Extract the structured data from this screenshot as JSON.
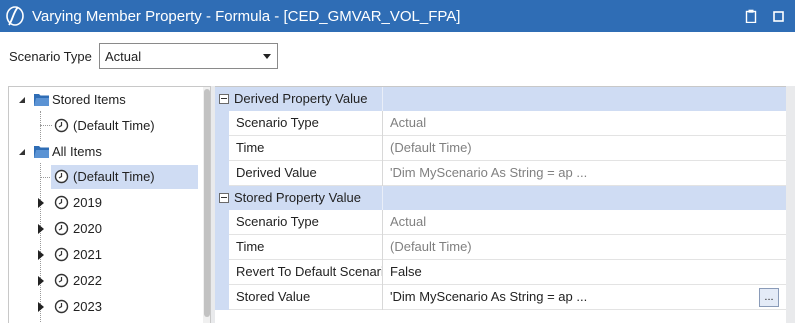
{
  "window": {
    "title": "Varying Member Property - Formula - [CED_GMVAR_VOL_FPA]",
    "logo_icon": "onestream-logo-icon",
    "buttons": [
      "clipboard-icon",
      "maximize-icon"
    ],
    "colors": {
      "titlebar": "#2f6db5",
      "selection": "#cfdcf3"
    }
  },
  "scenario": {
    "label": "Scenario Type",
    "value": "Actual"
  },
  "tree": {
    "nodes": [
      {
        "label": "Stored Items",
        "icon": "folder-icon",
        "expanded": true
      },
      {
        "label": "(Default Time)",
        "icon": "clock-icon"
      },
      {
        "label": "All Items",
        "icon": "folder-icon",
        "expanded": true
      },
      {
        "label": "(Default Time)",
        "icon": "clock-icon",
        "selected": true
      },
      {
        "label": "2019",
        "icon": "clock-icon",
        "expanded": false
      },
      {
        "label": "2020",
        "icon": "clock-icon",
        "expanded": false
      },
      {
        "label": "2021",
        "icon": "clock-icon",
        "expanded": false
      },
      {
        "label": "2022",
        "icon": "clock-icon",
        "expanded": false
      },
      {
        "label": "2023",
        "icon": "clock-icon",
        "expanded": false
      }
    ]
  },
  "grid": {
    "derived": {
      "title": "Derived Property Value",
      "rows": [
        {
          "name": "Scenario Type",
          "value": "Actual"
        },
        {
          "name": "Time",
          "value": "(Default Time)"
        },
        {
          "name": "Derived Value",
          "value": "'Dim MyScenario As String = ap ..."
        }
      ]
    },
    "stored": {
      "title": "Stored Property Value",
      "rows": [
        {
          "name": "Scenario Type",
          "value": "Actual"
        },
        {
          "name": "Time",
          "value": "(Default Time)"
        },
        {
          "name": "Revert To Default Scenario Type",
          "value": "False"
        },
        {
          "name": "Stored Value",
          "value": "'Dim MyScenario As String = ap ...",
          "button": "..."
        }
      ]
    }
  }
}
